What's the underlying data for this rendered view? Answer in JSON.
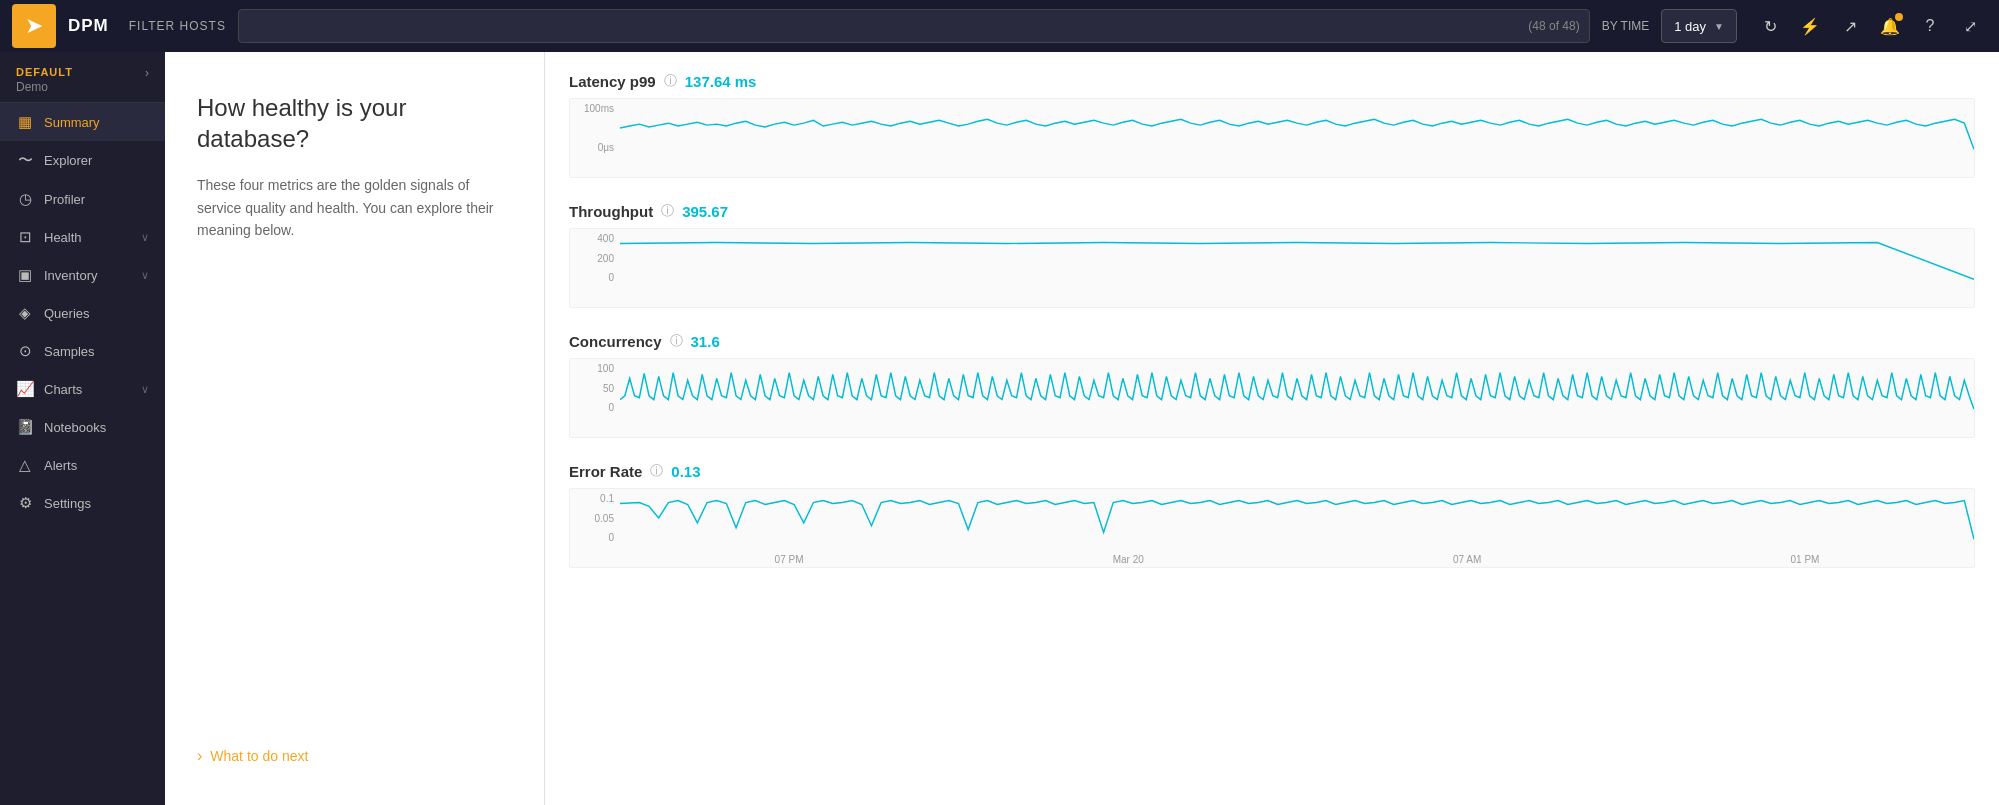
{
  "topbar": {
    "logo_symbol": "➤",
    "app_title": "DPM",
    "filter_label": "FILTER HOSTS",
    "filter_placeholder": "",
    "filter_count": "(48 of 48)",
    "by_time_label": "BY TIME",
    "time_selected": "1 day",
    "icons": {
      "refresh": "↻",
      "lightning": "⚡",
      "share": "↗",
      "bell": "🔔",
      "help": "?",
      "expand": "⤢"
    }
  },
  "sidebar": {
    "workspace_label": "DEFAULT",
    "workspace_sub": "Demo",
    "items": [
      {
        "id": "summary",
        "label": "Summary",
        "icon": "▦",
        "active": true,
        "has_chevron": false
      },
      {
        "id": "explorer",
        "label": "Explorer",
        "icon": "〜",
        "active": false,
        "has_chevron": false
      },
      {
        "id": "profiler",
        "label": "Profiler",
        "icon": "◷",
        "active": false,
        "has_chevron": false
      },
      {
        "id": "health",
        "label": "Health",
        "icon": "⊡",
        "active": false,
        "has_chevron": true
      },
      {
        "id": "inventory",
        "label": "Inventory",
        "icon": "▣",
        "active": false,
        "has_chevron": true
      },
      {
        "id": "queries",
        "label": "Queries",
        "icon": "◈",
        "active": false,
        "has_chevron": false
      },
      {
        "id": "samples",
        "label": "Samples",
        "icon": "⊙",
        "active": false,
        "has_chevron": false
      },
      {
        "id": "charts",
        "label": "Charts",
        "icon": "📈",
        "active": false,
        "has_chevron": true
      },
      {
        "id": "notebooks",
        "label": "Notebooks",
        "icon": "📓",
        "active": false,
        "has_chevron": false
      },
      {
        "id": "alerts",
        "label": "Alerts",
        "icon": "△",
        "active": false,
        "has_chevron": false
      },
      {
        "id": "settings",
        "label": "Settings",
        "icon": "⚙",
        "active": false,
        "has_chevron": false
      }
    ]
  },
  "summary": {
    "heading": "How healthy is your database?",
    "description": "These four metrics are the golden signals of service quality and health. You can explore their meaning below.",
    "what_next_label": "What to do next"
  },
  "metrics": [
    {
      "id": "latency",
      "name": "Latency p99",
      "value": "137.64 ms",
      "y_labels": [
        "100ms",
        "0μs"
      ],
      "color": "#00bcd4"
    },
    {
      "id": "throughput",
      "name": "Throughput",
      "value": "395.67",
      "y_labels": [
        "400",
        "200",
        "0"
      ],
      "color": "#00bcd4"
    },
    {
      "id": "concurrency",
      "name": "Concurrency",
      "value": "31.6",
      "y_labels": [
        "100",
        "50",
        "0"
      ],
      "color": "#00bcd4"
    },
    {
      "id": "error_rate",
      "name": "Error Rate",
      "value": "0.13",
      "y_labels": [
        "0.1",
        "0.05",
        "0"
      ],
      "color": "#00bcd4"
    }
  ],
  "x_labels": [
    "07 PM",
    "Mar 20",
    "07 AM",
    "01 PM"
  ]
}
